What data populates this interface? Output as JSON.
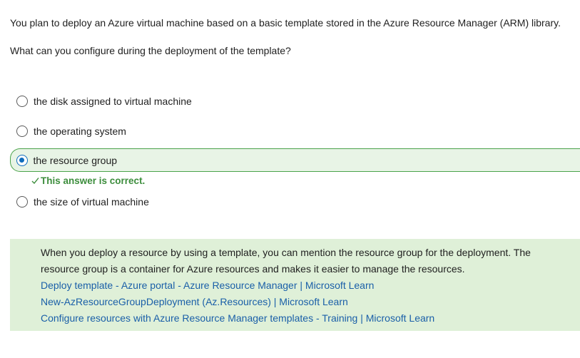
{
  "question": {
    "line1": "You plan to deploy an Azure virtual machine based on a basic template stored in the Azure Resource Manager (ARM) library.",
    "line2": "What can you configure during the deployment of the template?"
  },
  "options": [
    {
      "label": "the disk assigned to virtual machine",
      "selected": false
    },
    {
      "label": "the operating system",
      "selected": false
    },
    {
      "label": "the resource group",
      "selected": true
    },
    {
      "label": "the size of virtual machine",
      "selected": false
    }
  ],
  "feedback": {
    "text": "This answer is correct.",
    "color": "#3c8d3c"
  },
  "explanation": {
    "line1": "When you deploy a resource by using a template, you can mention the resource group for the deployment. The",
    "line2": "resource group is a container for Azure resources and makes it easier to manage the resources.",
    "links": [
      "Deploy template - Azure portal - Azure Resource Manager | Microsoft Learn",
      "New-AzResourceGroupDeployment (Az.Resources) | Microsoft Learn",
      "Configure resources with Azure Resource Manager templates - Training | Microsoft Learn"
    ]
  },
  "colors": {
    "correct_background": "#e8f4e6",
    "correct_border": "#4ba34b",
    "explanation_background": "#dff0d8",
    "link": "#1a5fa8",
    "radio_selected": "#0f6cbd"
  }
}
